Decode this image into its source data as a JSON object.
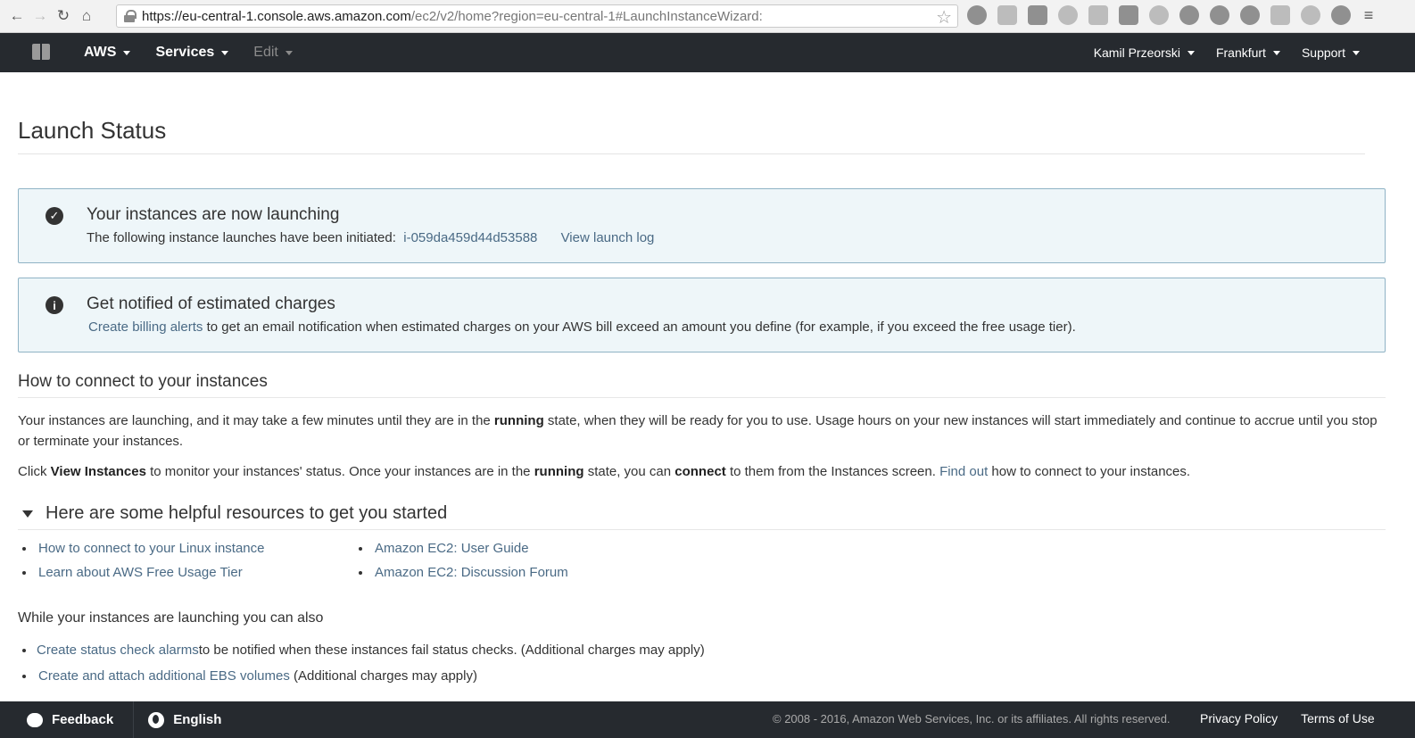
{
  "browser": {
    "url_host": "https://eu-central-1.console.aws.amazon.com",
    "url_path": "/ec2/v2/home?region=eu-central-1#LaunchInstanceWizard:"
  },
  "topnav": {
    "aws_label": "AWS",
    "services_label": "Services",
    "edit_label": "Edit",
    "user_label": "Kamil Przeorski",
    "region_label": "Frankfurt",
    "support_label": "Support"
  },
  "page": {
    "title": "Launch Status"
  },
  "alerts": {
    "launching": {
      "title": "Your instances are now launching",
      "text_prefix": "The following instance launches have been initiated:",
      "instance_id": "i-059da459d44d53588",
      "log_link": "View launch log"
    },
    "charges": {
      "title": "Get notified of estimated charges",
      "link": "Create billing alerts",
      "text": "to get an email notification when estimated charges on your AWS bill exceed an amount you define (for example, if you exceed the free usage tier)."
    }
  },
  "connect": {
    "title": "How to connect to your instances",
    "p1_a": "Your instances are launching, and it may take a few minutes until they are in the ",
    "p1_b": "running",
    "p1_c": " state, when they will be ready for you to use. Usage hours on your new instances will start immediately and continue to accrue until you stop or terminate your instances.",
    "p2_a": "Click ",
    "p2_b": "View Instances",
    "p2_c": " to monitor your instances' status. Once your instances are in the ",
    "p2_d": "running",
    "p2_e": " state, you can ",
    "p2_f": "connect",
    "p2_g": " to them from the Instances screen. ",
    "p2_link": "Find out",
    "p2_h": " how to connect to your instances."
  },
  "resources": {
    "title": "Here are some helpful resources to get you started",
    "items": [
      "How to connect to your Linux instance",
      "Amazon EC2: User Guide",
      "Learn about AWS Free Usage Tier",
      "Amazon EC2: Discussion Forum"
    ]
  },
  "also": {
    "title": "While your instances are launching you can also",
    "item1_link": "Create status check alarms",
    "item1_text": " to be notified when these instances fail status checks. (Additional charges may apply)",
    "item2_link": "Create and attach additional EBS volumes",
    "item2_text": " (Additional charges may apply)"
  },
  "footer": {
    "feedback": "Feedback",
    "language": "English",
    "copyright": "© 2008 - 2016, Amazon Web Services, Inc. or its affiliates. All rights reserved.",
    "privacy": "Privacy Policy",
    "terms": "Terms of Use"
  }
}
